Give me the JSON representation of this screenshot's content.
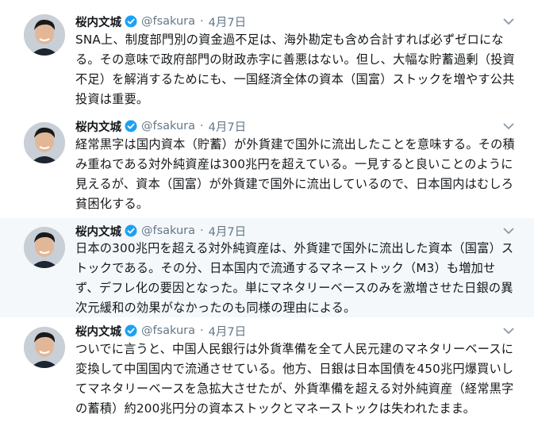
{
  "tweets": [
    {
      "author": "桜内文城",
      "handle": "@fsakura",
      "separator": "·",
      "date": "4月7日",
      "lines": [
        "SNA上、制度部門別の資金過不足は、海外勘定も含め合計すれば必ずゼロにな",
        "る。その意味で政府部門の財政赤字に善悪はない。但し、大幅な貯蓄過剰（投資",
        "不足）を解消するためにも、一国経済全体の資本（国富）ストックを増やす公共",
        "投資は重要。"
      ]
    },
    {
      "author": "桜内文城",
      "handle": "@fsakura",
      "separator": "·",
      "date": "4月7日",
      "lines": [
        "経常黒字は国内資本（貯蓄）が外貨建で国外に流出したことを意味する。その積",
        "み重ねである対外純資産は300兆円を超えている。一見すると良いことのように",
        "見えるが、資本（国富）が外貨建で国外に流出しているので、日本国内はむしろ",
        "貧困化する。"
      ]
    },
    {
      "author": "桜内文城",
      "handle": "@fsakura",
      "separator": "·",
      "date": "4月7日",
      "lines": [
        "日本の300兆円を超える対外純資産は、外貨建で国外に流出した資本（国富）ス",
        "トックである。その分、日本国内で流通するマネーストック（M3）も増加せ",
        "ず、デフレ化の要因となった。単にマネタリーベースのみを激増させた日銀の異",
        "次元緩和の効果がなかったのも同様の理由による。"
      ]
    },
    {
      "author": "桜内文城",
      "handle": "@fsakura",
      "separator": "·",
      "date": "4月7日",
      "lines": [
        "ついでに言うと、中国人民銀行は外貨準備を全て人民元建のマネタリーベースに",
        "変換して中国国内で流通させている。他方、日銀は日本国債を450兆円爆買いし",
        "てマネタリーベースを急拡大させたが、外貨準備を超える対外純資産（経常黒字",
        "の蓄積）約200兆円分の資本ストックとマネーストックは失われたまま。"
      ]
    }
  ],
  "colors": {
    "verified": "#1da1f2",
    "secondary_text": "#657786",
    "highlight_bg": "#f5f8fa"
  },
  "icons": {
    "verified": "verified-badge-icon",
    "caret": "chevron-down-icon"
  }
}
